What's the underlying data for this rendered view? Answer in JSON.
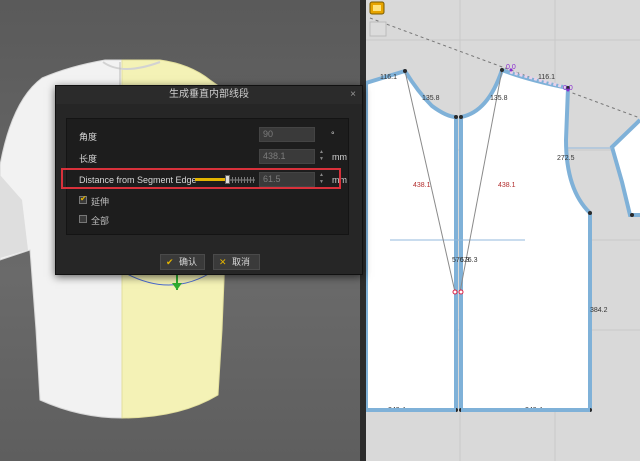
{
  "dialog": {
    "title": "生成垂直内部线段",
    "close_glyph": "×",
    "angle": {
      "label": "角度",
      "value": "90",
      "unit": "°"
    },
    "length": {
      "label": "长度",
      "value": "438.1",
      "unit": "mm"
    },
    "distance": {
      "label": "Distance from Segment Edge",
      "value": "61.5",
      "unit": "mm"
    },
    "extend": {
      "label": "延伸",
      "checked": true
    },
    "all": {
      "label": "全部",
      "checked": false
    },
    "ok_label": "确认",
    "cancel_label": "取消"
  },
  "pattern_labels": {
    "a": "116.1",
    "b": "135.8",
    "c": "135.8",
    "d": "116.1",
    "e": "0.0",
    "f": "0.0",
    "g": "438.1",
    "h": "438.1",
    "i": "272.5",
    "j": "576.3",
    "k": "576.3",
    "l": "384.2",
    "m": "249.4",
    "n": "249.4"
  },
  "colors": {
    "accent": "#e3b400",
    "highlight": "#d9313b",
    "pattern_outline": "#7fb1d8",
    "garment_right": "#f4f2b6",
    "garment_left": "#f3f3f3"
  }
}
